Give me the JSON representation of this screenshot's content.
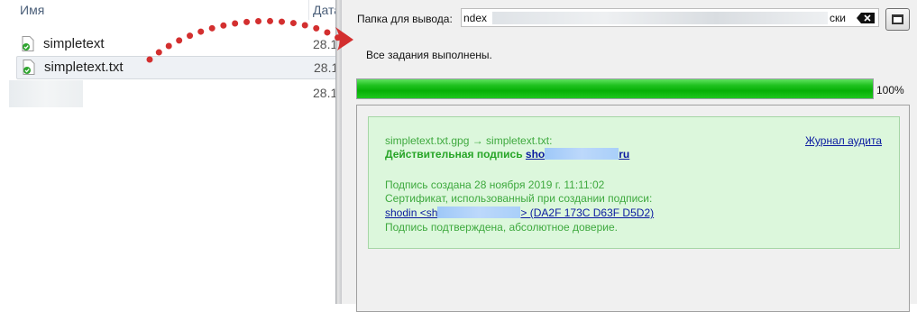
{
  "explorer": {
    "col_name": "Имя",
    "col_date": "Дата",
    "files": [
      {
        "name": "simpletext",
        "date": "28.1"
      },
      {
        "name": "simpletext.txt",
        "date": "28.1"
      },
      {
        "name": "",
        "date": "28.1"
      }
    ]
  },
  "gpg": {
    "output_label": "Папка для вывода:",
    "output_path_prefix": "ndex",
    "output_path_suffix": "ски",
    "status": "Все задания выполнены.",
    "progress_percent": 100,
    "progress_label": "100%",
    "signature": {
      "files": "simpletext.txt.gpg → simpletext.txt:",
      "valid_label": "Действительная подпись",
      "signer_start": "sho",
      "signer_end": "ru",
      "audit_link": "Журнал аудита",
      "created": "Подпись создана 28 ноября 2019 г. 11:11:02",
      "cert_label": "Сертификат, использованный при создании подписи:",
      "cert_start": "shodin <sh",
      "cert_end": "> (DA2F 173C D63F D5D2)",
      "confirmed": "Подпись подтверждена, абсолютное доверие."
    }
  },
  "colors": {
    "progress_green": "#06b006",
    "signature_bg": "#dcf7dc",
    "signature_text": "#3ea93e",
    "link": "#0a1aa0",
    "arrow": "#d32f2f"
  }
}
